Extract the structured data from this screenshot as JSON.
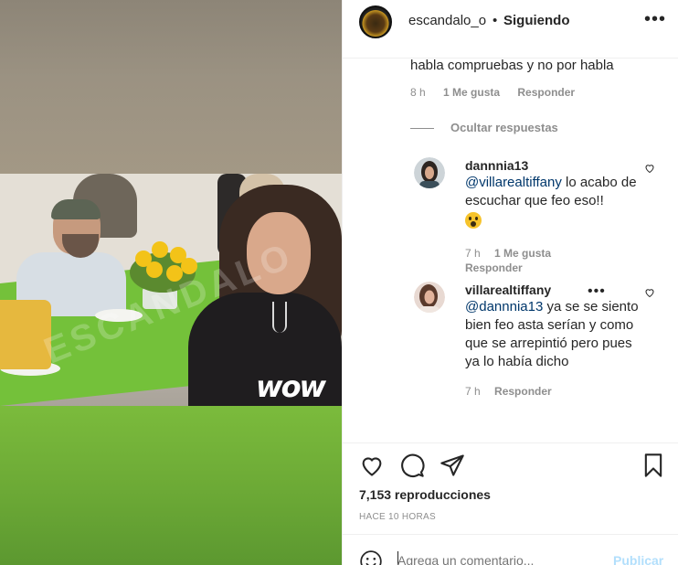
{
  "media": {
    "watermark_text": "ESCANDALO",
    "sticker_text": "wow"
  },
  "header": {
    "username": "escandalo_o",
    "separator": "•",
    "follow_status": "Siguiendo",
    "more_icon": "more-horizontal-icon"
  },
  "comment": {
    "text_tail": "habla compruebas y no por habla",
    "time": "8 h",
    "likes": "1 Me gusta",
    "reply_label": "Responder"
  },
  "hide_replies_label": "Ocultar respuestas",
  "replies": [
    {
      "username": "dannnia13",
      "mention": "@villarealtiffany",
      "text": " lo acabo de escuchar que feo eso!!",
      "emoji": "astonished-face-emoji",
      "time": "7 h",
      "likes": "1 Me gusta",
      "reply_label": "Responder"
    },
    {
      "username": "villarealtiffany",
      "mention": "@dannnia13",
      "text": " ya se se siento bien feo asta serían y como que se arrepintió pero pues ya lo había dicho",
      "time": "7 h",
      "reply_label": "Responder"
    }
  ],
  "actions": {
    "views_count": "7,153",
    "views_label": " reproducciones",
    "time_ago": "HACE 10 HORAS"
  },
  "add_comment": {
    "placeholder": "Agrega un comentario...",
    "post_label": "Publicar"
  }
}
